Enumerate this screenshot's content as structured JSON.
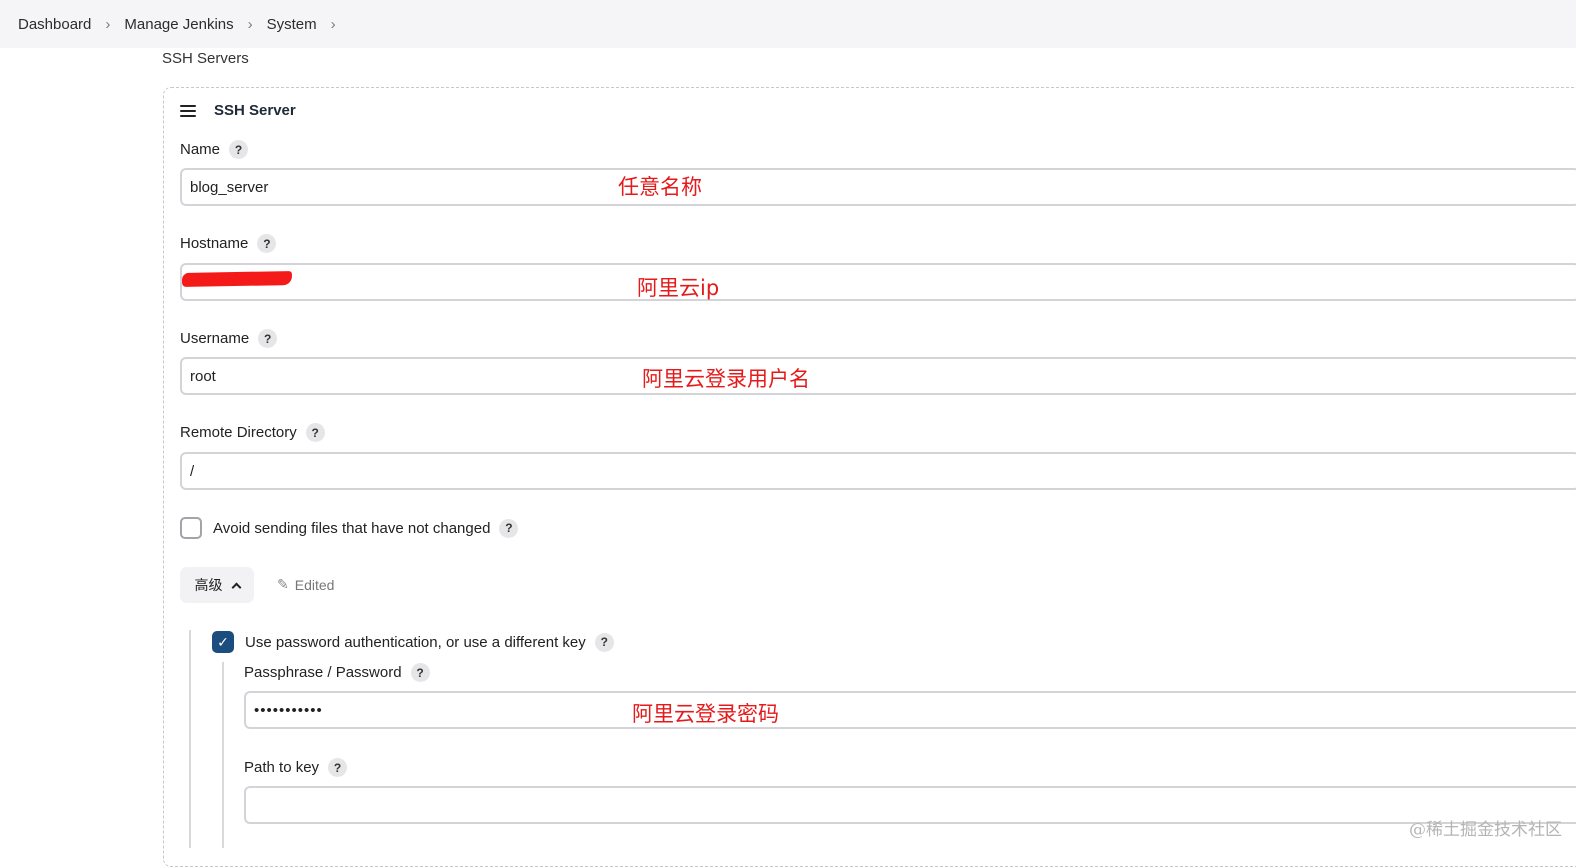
{
  "breadcrumb": {
    "items": [
      "Dashboard",
      "Manage Jenkins",
      "System"
    ]
  },
  "section": {
    "title": "SSH Servers"
  },
  "server": {
    "header": "SSH Server",
    "fields": {
      "name": {
        "label": "Name",
        "value": "blog_server",
        "annotation": "任意名称"
      },
      "hostname": {
        "label": "Hostname",
        "value": "",
        "annotation": "阿里云ip"
      },
      "username": {
        "label": "Username",
        "value": "root",
        "annotation": "阿里云登录用户名"
      },
      "remote_directory": {
        "label": "Remote Directory",
        "value": "/"
      }
    },
    "avoid_sending": {
      "label": "Avoid sending files that have not changed",
      "checked": false
    },
    "advanced": {
      "label": "高级",
      "edited_label": "Edited"
    },
    "password_auth": {
      "label": "Use password authentication, or use a different key",
      "checked": true
    },
    "passphrase": {
      "label": "Passphrase / Password",
      "value": "•••••••••••",
      "annotation": "阿里云登录密码"
    },
    "path_to_key": {
      "label": "Path to key",
      "value": ""
    }
  },
  "help_symbol": "?",
  "check_symbol": "✓",
  "watermark": "@稀土掘金技术社区",
  "colors": {
    "annotation": "#e51a1a",
    "checkbox_checked": "#1b4d7e",
    "breadcrumb_bg": "#f5f5f7"
  }
}
